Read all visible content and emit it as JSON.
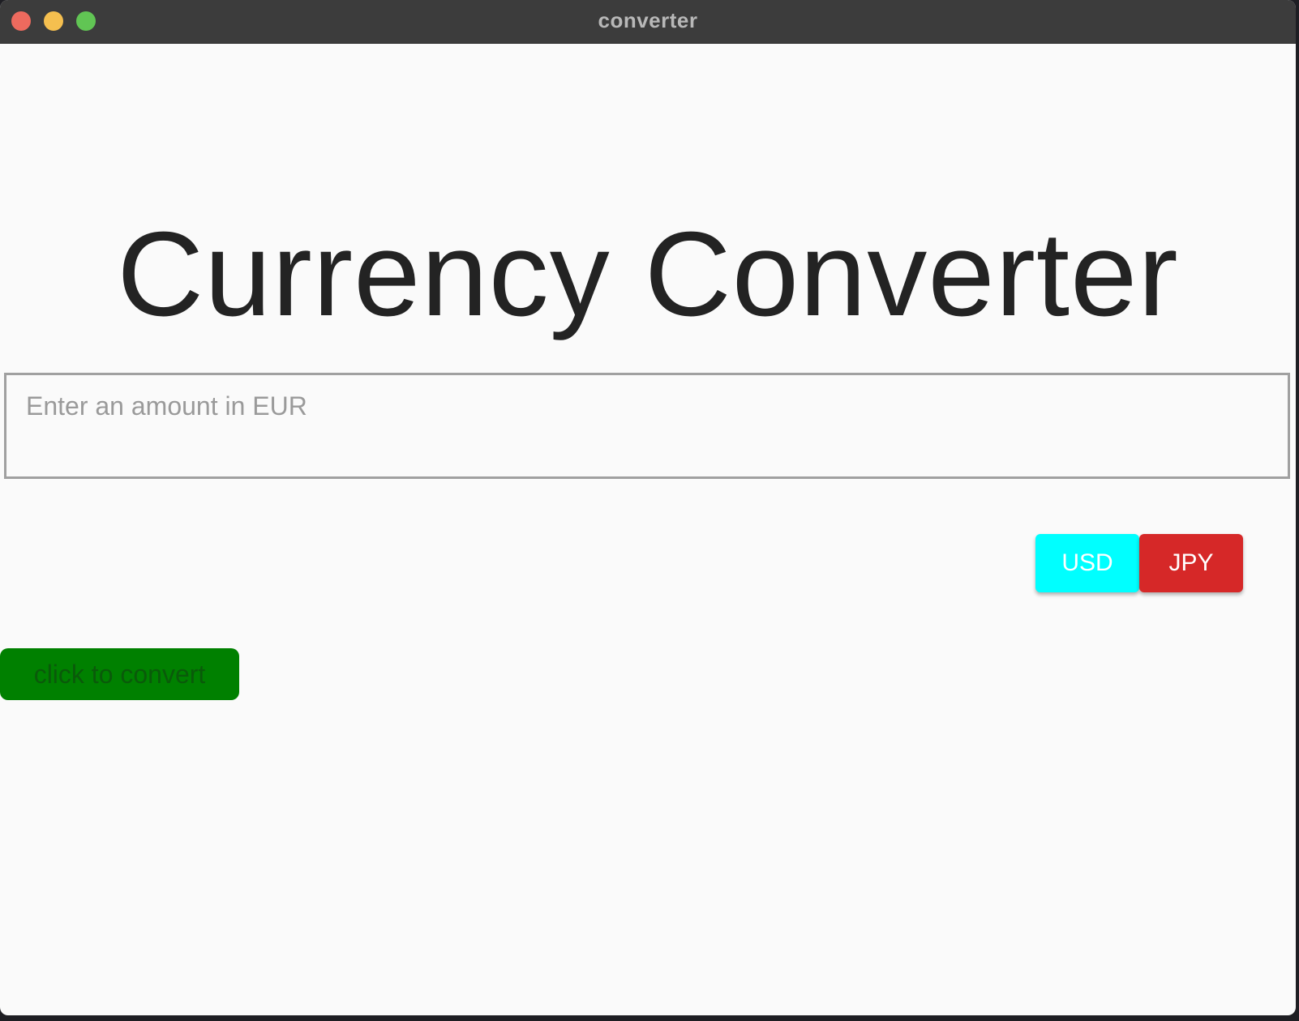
{
  "window": {
    "title": "converter"
  },
  "main": {
    "heading": "Currency Converter",
    "amount_input": {
      "value": "",
      "placeholder": "Enter an amount in EUR"
    },
    "currency_buttons": [
      {
        "label": "USD",
        "color": "#00ffff"
      },
      {
        "label": "JPY",
        "color": "#d62828"
      }
    ],
    "convert_button": {
      "label": "click to convert",
      "color": "#008000"
    }
  },
  "colors": {
    "titlebar": "#3c3c3c",
    "background": "#fafafa",
    "close": "#ed6a5e",
    "minimize": "#f5bf4f",
    "maximize": "#61c554"
  }
}
